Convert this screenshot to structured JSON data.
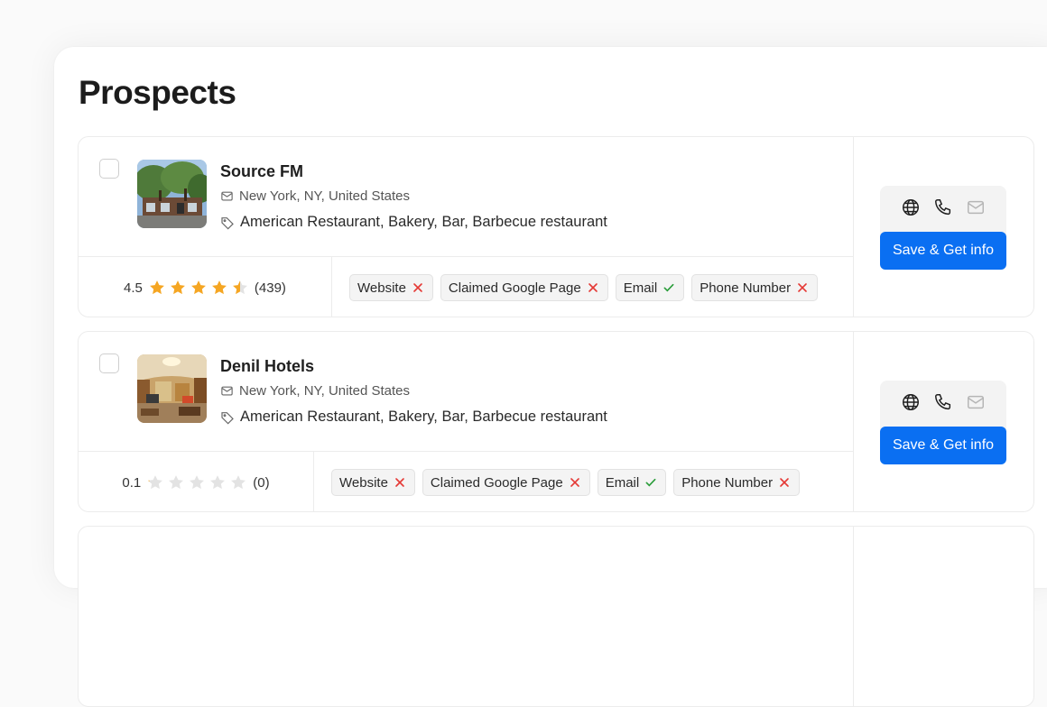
{
  "page": {
    "title": "Prospects"
  },
  "colors": {
    "accent": "#0a6ff2",
    "star_filled": "#f5a623",
    "star_empty": "#e3e3e3",
    "check": "#2a9d3a",
    "cross": "#e53935"
  },
  "prospects": [
    {
      "name": "Source FM",
      "location": "New York, NY, United States",
      "categories": "American Restaurant, Bakery, Bar, Barbecue restaurant",
      "rating": "4.5",
      "rating_value": 4.5,
      "review_count": "(439)",
      "chips": [
        {
          "label": "Website",
          "status": "cross"
        },
        {
          "label": "Claimed Google Page",
          "status": "cross"
        },
        {
          "label": "Email",
          "status": "check"
        },
        {
          "label": "Phone Number",
          "status": "cross"
        }
      ],
      "icons": [
        "globe-icon",
        "phone-icon",
        "mail-icon"
      ],
      "button_label": "Save & Get info"
    },
    {
      "name": "Denil Hotels",
      "location": "New York, NY, United States",
      "categories": "American Restaurant, Bakery, Bar, Barbecue restaurant",
      "rating": "0.1",
      "rating_value": 0.1,
      "review_count": "(0)",
      "chips": [
        {
          "label": "Website",
          "status": "cross"
        },
        {
          "label": "Claimed Google Page",
          "status": "cross"
        },
        {
          "label": "Email",
          "status": "check"
        },
        {
          "label": "Phone Number",
          "status": "cross"
        }
      ],
      "icons": [
        "globe-icon",
        "phone-icon",
        "mail-icon"
      ],
      "button_label": "Save & Get info"
    }
  ]
}
